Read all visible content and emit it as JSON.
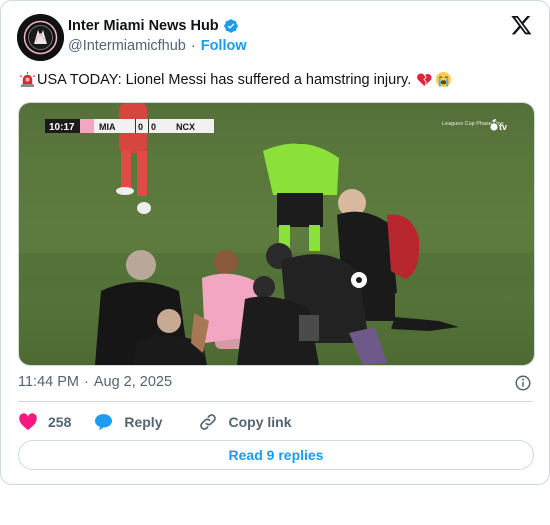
{
  "author": {
    "name": "Inter Miami News Hub",
    "handle": "@Intermiamicfhub",
    "separator": "·",
    "follow_label": "Follow"
  },
  "tweet": {
    "text": "USA TODAY: Lionel Messi has suffered a hamstring injury.",
    "emoji_leading": "rotating-light-icon",
    "emoji_trailing": [
      "broken-heart-icon",
      "loudly-crying-face-icon"
    ]
  },
  "media": {
    "clock": "10:17",
    "home_team": "MIA",
    "home_score": "0",
    "away_score": "0",
    "away_team": "NCX",
    "competition": "Leagues Cup Phase One",
    "broadcaster": "tv"
  },
  "meta": {
    "time": "11:44 PM",
    "separator": "·",
    "date": "Aug 2, 2025"
  },
  "actions": {
    "like_count": "258",
    "reply_label": "Reply",
    "copy_label": "Copy link"
  },
  "read_replies_label": "Read 9 replies",
  "colors": {
    "accent": "#1d9bf0",
    "like": "#f91880",
    "muted": "#536471",
    "border": "#cfd9de"
  }
}
